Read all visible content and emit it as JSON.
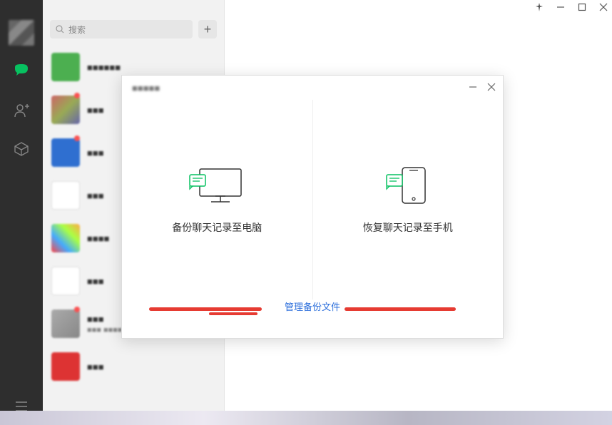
{
  "window_controls": {
    "pin_label": "固定",
    "min_label": "最小化",
    "max_label": "最大化",
    "close_label": "关闭"
  },
  "search": {
    "placeholder": "搜索"
  },
  "plus_label": "+",
  "chats": [
    {
      "name": "■■■■■■",
      "sub": "",
      "ava": "#4caf50",
      "dot": false
    },
    {
      "name": "■■■",
      "sub": "",
      "ava": "linear-gradient(135deg,#c66,#9a5,#66a)",
      "dot": true
    },
    {
      "name": "■■■",
      "sub": "",
      "ava": "#2f6fd0",
      "dot": true
    },
    {
      "name": "■■■",
      "sub": "",
      "ava": "#fff",
      "dot": false
    },
    {
      "name": "■■■■",
      "sub": "",
      "ava": "linear-gradient(45deg,#f44,#4af,#af4,#fa4)",
      "dot": false
    },
    {
      "name": "■■■",
      "sub": "",
      "ava": "#fff",
      "dot": false
    },
    {
      "name": "■■■",
      "sub": "■■■ ■■■■■■■■ ■",
      "ava": "linear-gradient(135deg,#aaa,#888)",
      "dot": true
    },
    {
      "name": "■■■",
      "sub": "",
      "ava": "#d33",
      "dot": false
    }
  ],
  "dialog": {
    "title": "■■■■■",
    "backup_label": "备份聊天记录至电脑",
    "restore_label": "恢复聊天记录至手机",
    "manage_label": "管理备份文件"
  }
}
